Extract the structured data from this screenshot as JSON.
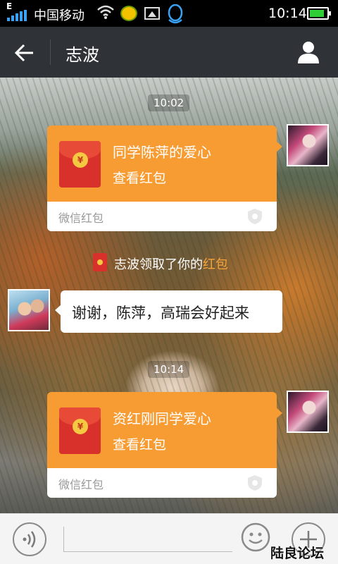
{
  "status_bar": {
    "network_type": "E",
    "carrier": "中国移动",
    "time": "10:14",
    "battery_level": 0.85,
    "icons": [
      "signal-icon",
      "wifi-icon",
      "app-notification-icon",
      "gallery-icon",
      "qq-icon",
      "battery-icon"
    ]
  },
  "header": {
    "title": "志波",
    "back_icon": "arrow-left-icon",
    "profile_icon": "person-icon"
  },
  "messages": [
    {
      "type": "timestamp",
      "text": "10:02"
    },
    {
      "type": "red_packet",
      "from": "me",
      "title": "同学陈萍的爱心",
      "subtitle": "查看红包",
      "brand": "微信红包",
      "coin_symbol": "¥"
    },
    {
      "type": "system",
      "prefix": "志波领取了你的",
      "link": "红包"
    },
    {
      "type": "text",
      "from": "志波",
      "text": "谢谢，陈萍，高瑞会好起来"
    },
    {
      "type": "timestamp",
      "text": "10:14"
    },
    {
      "type": "red_packet",
      "from": "me",
      "title": "资红刚同学爱心",
      "subtitle": "查看红包",
      "brand": "微信红包",
      "coin_symbol": "¥"
    }
  ],
  "input_bar": {
    "voice_icon": "voice-icon",
    "input_value": "",
    "emoji_icon": "smiley-icon",
    "more_icon": "plus-icon"
  },
  "watermark": "陆良论坛",
  "colors": {
    "red_packet_orange": "#f79c33",
    "envelope_red": "#d8302a",
    "title_bar": "#2f3337",
    "link_orange": "#f7a53a"
  }
}
